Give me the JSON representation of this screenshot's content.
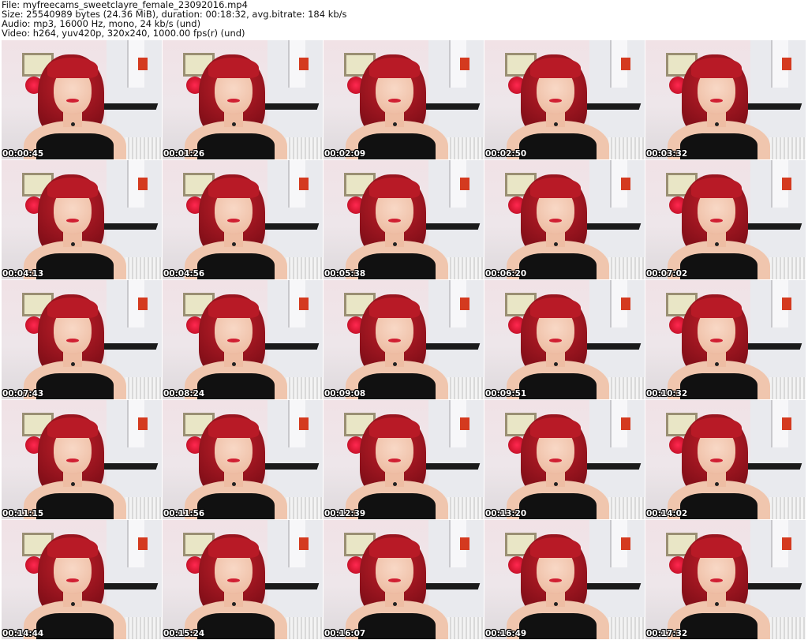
{
  "header": {
    "file_line": "File: myfreecams_sweetclayre_female_23092016.mp4",
    "size_line": "Size: 25540989 bytes (24.36 MiB), duration: 00:18:32, avg.bitrate: 184 kb/s",
    "audio_line": "Audio: mp3, 16000 Hz, mono, 24 kb/s (und)",
    "video_line": "Video: h264, yuv420p, 320x240, 1000.00 fps(r) (und)"
  },
  "thumbnails": [
    {
      "timestamp": "00:00:45"
    },
    {
      "timestamp": "00:01:26"
    },
    {
      "timestamp": "00:02:09"
    },
    {
      "timestamp": "00:02:50"
    },
    {
      "timestamp": "00:03:32"
    },
    {
      "timestamp": "00:04:13"
    },
    {
      "timestamp": "00:04:56"
    },
    {
      "timestamp": "00:05:38"
    },
    {
      "timestamp": "00:06:20"
    },
    {
      "timestamp": "00:07:02"
    },
    {
      "timestamp": "00:07:43"
    },
    {
      "timestamp": "00:08:24"
    },
    {
      "timestamp": "00:09:08"
    },
    {
      "timestamp": "00:09:51"
    },
    {
      "timestamp": "00:10:32"
    },
    {
      "timestamp": "00:11:15"
    },
    {
      "timestamp": "00:11:56"
    },
    {
      "timestamp": "00:12:39"
    },
    {
      "timestamp": "00:13:20"
    },
    {
      "timestamp": "00:14:02"
    },
    {
      "timestamp": "00:14:44"
    },
    {
      "timestamp": "00:15:24"
    },
    {
      "timestamp": "00:16:07"
    },
    {
      "timestamp": "00:16:49"
    },
    {
      "timestamp": "00:17:32"
    }
  ]
}
